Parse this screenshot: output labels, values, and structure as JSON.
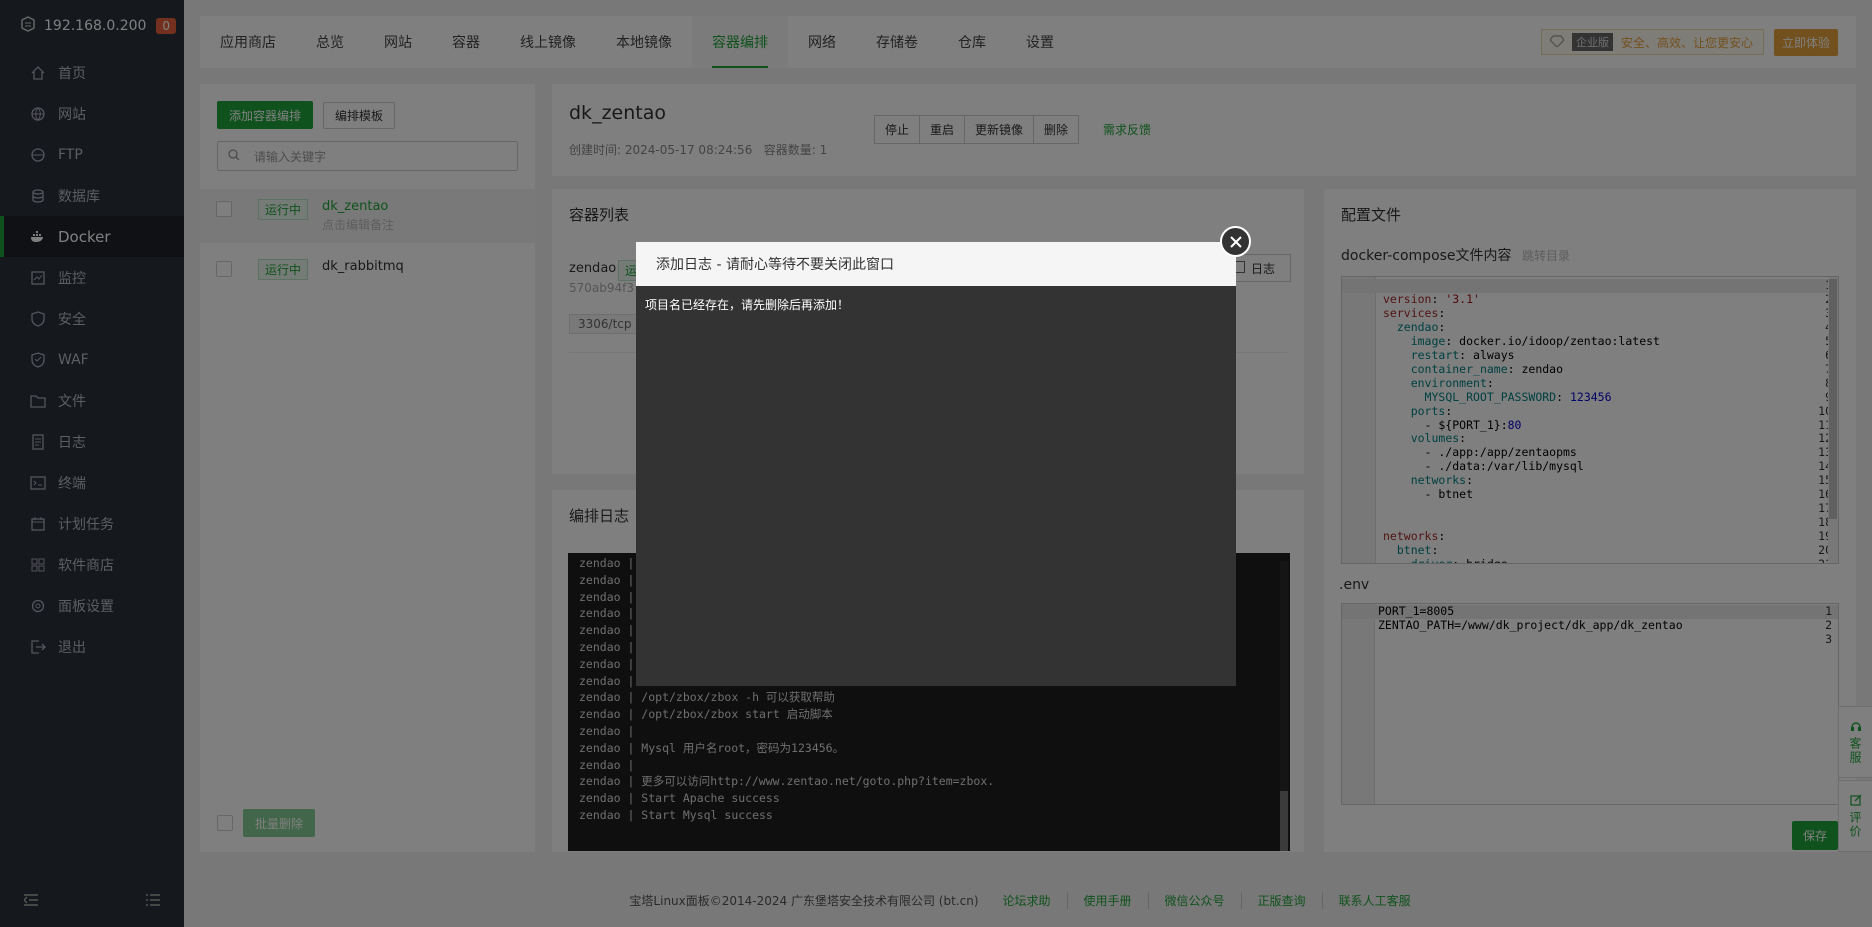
{
  "sidebar": {
    "ip": "192.168.0.200",
    "badge": "0",
    "items": [
      {
        "label": "首页",
        "icon": "home-icon"
      },
      {
        "label": "网站",
        "icon": "globe-icon"
      },
      {
        "label": "FTP",
        "icon": "ftp-icon"
      },
      {
        "label": "数据库",
        "icon": "database-icon"
      },
      {
        "label": "Docker",
        "icon": "docker-icon"
      },
      {
        "label": "监控",
        "icon": "monitor-icon"
      },
      {
        "label": "安全",
        "icon": "shield-icon"
      },
      {
        "label": "WAF",
        "icon": "waf-icon"
      },
      {
        "label": "文件",
        "icon": "folder-icon"
      },
      {
        "label": "日志",
        "icon": "log-icon"
      },
      {
        "label": "终端",
        "icon": "terminal-icon"
      },
      {
        "label": "计划任务",
        "icon": "calendar-icon"
      },
      {
        "label": "软件商店",
        "icon": "grid-icon"
      },
      {
        "label": "面板设置",
        "icon": "settings-icon"
      },
      {
        "label": "退出",
        "icon": "logout-icon"
      }
    ]
  },
  "topnav": {
    "tabs": [
      "应用商店",
      "总览",
      "网站",
      "容器",
      "线上镜像",
      "本地镜像",
      "容器编排",
      "网络",
      "存储卷",
      "仓库",
      "设置"
    ],
    "enterprise_tag": "企业版",
    "enterprise_text": "安全、高效、让您更安心",
    "try_button": "立即体验"
  },
  "compose_panel": {
    "add_button": "添加容器编排",
    "template_button": "编排模板",
    "search_placeholder": "请输入关键字",
    "items": [
      {
        "status": "运行中",
        "name": "dk_zentao",
        "remark": "点击编辑备注"
      },
      {
        "status": "运行中",
        "name": "dk_rabbitmq",
        "remark": ""
      }
    ],
    "batch_delete": "批量删除"
  },
  "project": {
    "title": "dk_zentao",
    "created_label": "创建时间:",
    "created_time": "2024-05-17 08:24:56",
    "count_label": "容器数量:",
    "count": "1",
    "buttons": [
      "停止",
      "重启",
      "更新镜像",
      "删除"
    ],
    "feedback": "需求反馈"
  },
  "container_list": {
    "title": "容器列表",
    "container_name": "zendao",
    "container_status": "运",
    "container_id": "570ab94f3",
    "port": "3306/tcp",
    "log_button": "日志"
  },
  "compose_log": {
    "title": "编排日志",
    "lines": [
      "zendao |",
      "zendao |",
      "zendao |",
      "zendao |",
      "zendao |",
      "zendao |",
      "zendao |",
      "zendao |",
      "zendao | /opt/zbox/zbox -h 可以获取帮助",
      "zendao | /opt/zbox/zbox start 启动脚本",
      "zendao |",
      "zendao | Mysql 用户名root，密码为123456。",
      "zendao |",
      "zendao | 更多可以访问http://www.zentao.net/goto.php?item=zbox.",
      "zendao | Start Apache success",
      "zendao | Start Mysql success"
    ]
  },
  "config": {
    "title": "配置文件",
    "compose_label": "docker-compose文件内容",
    "jump_dir": "跳转目录",
    "env_label": ".env",
    "save_button": "保存",
    "compose_lines": [
      "",
      "version: '3.1'",
      "services:",
      "  zendao:",
      "    image: docker.io/idoop/zentao:latest",
      "    restart: always",
      "    container_name: zendao",
      "    environment:",
      "      MYSQL_ROOT_PASSWORD: 123456",
      "    ports:",
      "      - ${PORT_1}:80",
      "    volumes:",
      "      - ./app:/app/zentaopms",
      "      - ./data:/var/lib/mysql",
      "    networks:",
      "      - btnet",
      "",
      "",
      "networks:",
      "  btnet:",
      "    driver: bridge"
    ],
    "env_lines": [
      "PORT_1=8005",
      "ZENTAO_PATH=/www/dk_project/dk_app/dk_zentao",
      ""
    ]
  },
  "side_float": {
    "service": "客服",
    "rate": "评价"
  },
  "footer": {
    "copyright": "宝塔Linux面板©2014-2024 广东堡塔安全技术有限公司 (bt.cn)",
    "links": [
      "论坛求助",
      "使用手册",
      "微信公众号",
      "正版查询",
      "联系人工客服"
    ]
  },
  "modal": {
    "title": "添加日志 - 请耐心等待不要关闭此窗口",
    "message": "项目名已经存在，请先删除后再添加！"
  },
  "colors": {
    "accent": "#20a53a",
    "sidebar_bg": "#2b3038",
    "gold": "#e6a23c",
    "badge": "#e8603c"
  }
}
